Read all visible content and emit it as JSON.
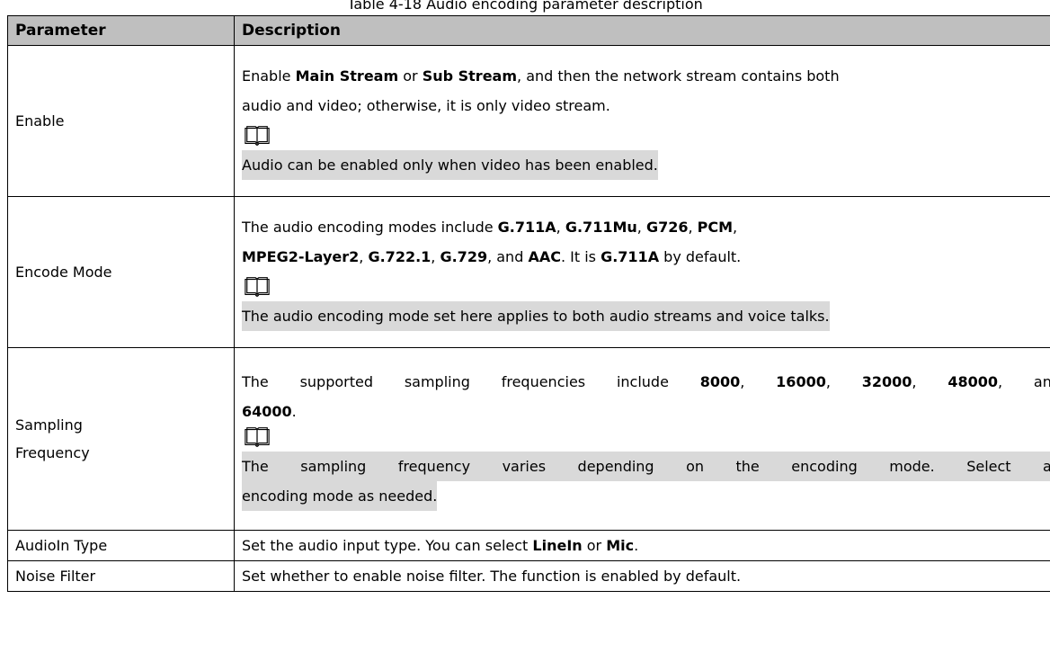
{
  "caption_fragment": "Table 4-18 Audio encoding parameter description",
  "table": {
    "headers": {
      "parameter": "Parameter",
      "description": "Description"
    },
    "rows": [
      {
        "parameter": "Enable",
        "desc_line1": [
          "Enable ",
          "Main Stream",
          " or ",
          "Sub Stream",
          ", and then the network stream contains both"
        ],
        "desc_line2": "audio and video; otherwise, it is only video stream.",
        "note": "Audio can be enabled only when video has been enabled."
      },
      {
        "parameter": "Encode Mode",
        "desc_line1": [
          "The audio encoding modes include ",
          "G.711A",
          ", ",
          "G.711Mu",
          ", ",
          "G726",
          ", ",
          "PCM",
          ","
        ],
        "desc_line2": [
          "MPEG2-Layer2",
          ", ",
          "G.722.1",
          ", ",
          "G.729",
          ", and ",
          "AAC",
          ". It is ",
          "G.711A",
          " by default."
        ],
        "note": "The audio encoding mode set here applies to both audio streams and voice talks."
      },
      {
        "parameter_line1": "Sampling",
        "parameter_line2": "Frequency",
        "desc_line1": [
          "The supported sampling frequencies include ",
          "8000",
          ", ",
          "16000",
          ", ",
          "32000",
          ", ",
          "48000",
          ", and"
        ],
        "desc_line2": [
          "64000",
          "."
        ],
        "note_line1": "The sampling frequency varies depending on the encoding mode. Select an",
        "note_line2": "encoding mode as needed."
      },
      {
        "parameter": "AudioIn Type",
        "desc": [
          "Set the audio input type. You can select ",
          "LineIn",
          " or ",
          "Mic",
          "."
        ]
      },
      {
        "parameter": "Noise Filter",
        "desc": "Set whether to enable noise filter. The function is enabled by default."
      }
    ]
  },
  "icons": {
    "note_icon": "open-book-icon"
  },
  "colors": {
    "header_bg": "#bfbfbf",
    "note_highlight": "#d9d9d9",
    "border": "#000000"
  }
}
